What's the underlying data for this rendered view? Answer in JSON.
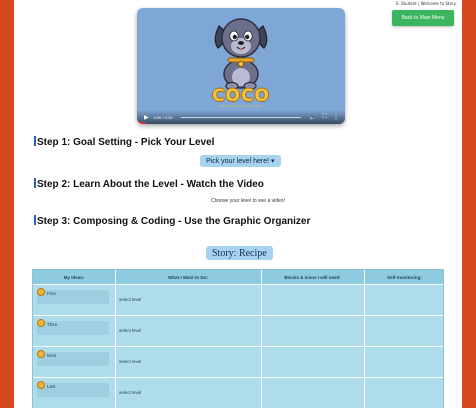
{
  "header": {
    "user_line": "S. Student | Welcome to Story",
    "back_button": "Back to Main Menu"
  },
  "video": {
    "title": "COCO",
    "subtitle": "COMPOSING & CODING",
    "time": "0:00 / 0:33",
    "colors": {
      "background": "#7ea7d8",
      "logo": "#f3c33f"
    }
  },
  "steps": [
    {
      "label": "Step 1: Goal Setting - Pick Your Level"
    },
    {
      "label": "Step 2: Learn About the Level - Watch the Video"
    },
    {
      "label": "Step 3: Composing & Coding - Use the Graphic Organizer"
    }
  ],
  "pick_level_button": "Pick your level here! ▾",
  "choose_level_text": "Choose your level to see a video!",
  "story_title": "Story: Recipe",
  "organizer": {
    "headers": [
      "My Ideas:",
      "What I Want to Do:",
      "Blocks & Icons I will need:",
      "Self-monitoring:"
    ],
    "rows": [
      {
        "label": "First",
        "value": "select level"
      },
      {
        "label": "Then",
        "value": "select level"
      },
      {
        "label": "Next",
        "value": "select level"
      },
      {
        "label": "Last",
        "value": "select level"
      }
    ]
  },
  "icons": [
    "play-icon",
    "volume-icon",
    "fullscreen-icon",
    "more-icon",
    "dog-mascot-icon",
    "step-bullet-icon"
  ]
}
